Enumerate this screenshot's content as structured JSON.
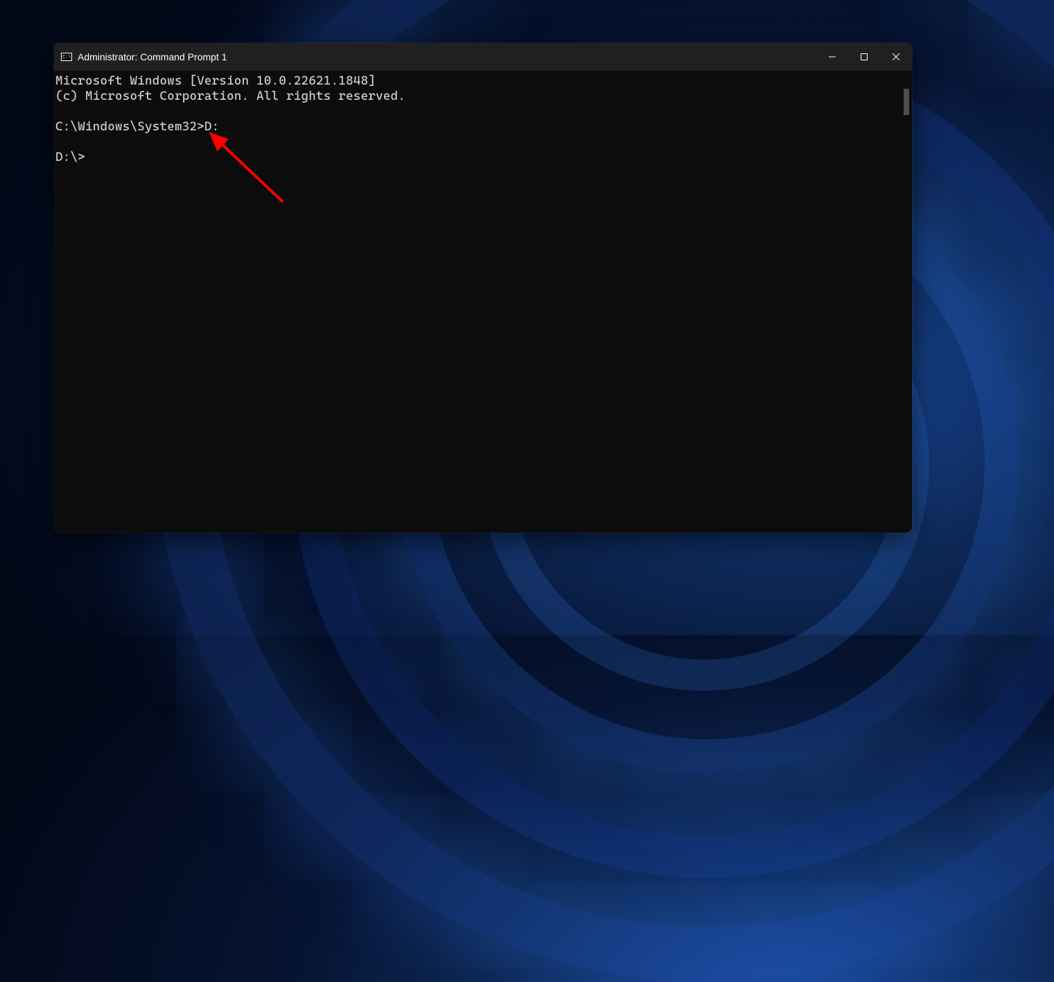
{
  "window": {
    "title": "Administrator: Command Prompt 1"
  },
  "terminal": {
    "lines": [
      "Microsoft Windows [Version 10.0.22621.1848]",
      "(c) Microsoft Corporation. All rights reserved.",
      "",
      "C:\\Windows\\System32>D:",
      "",
      "D:\\>"
    ]
  }
}
